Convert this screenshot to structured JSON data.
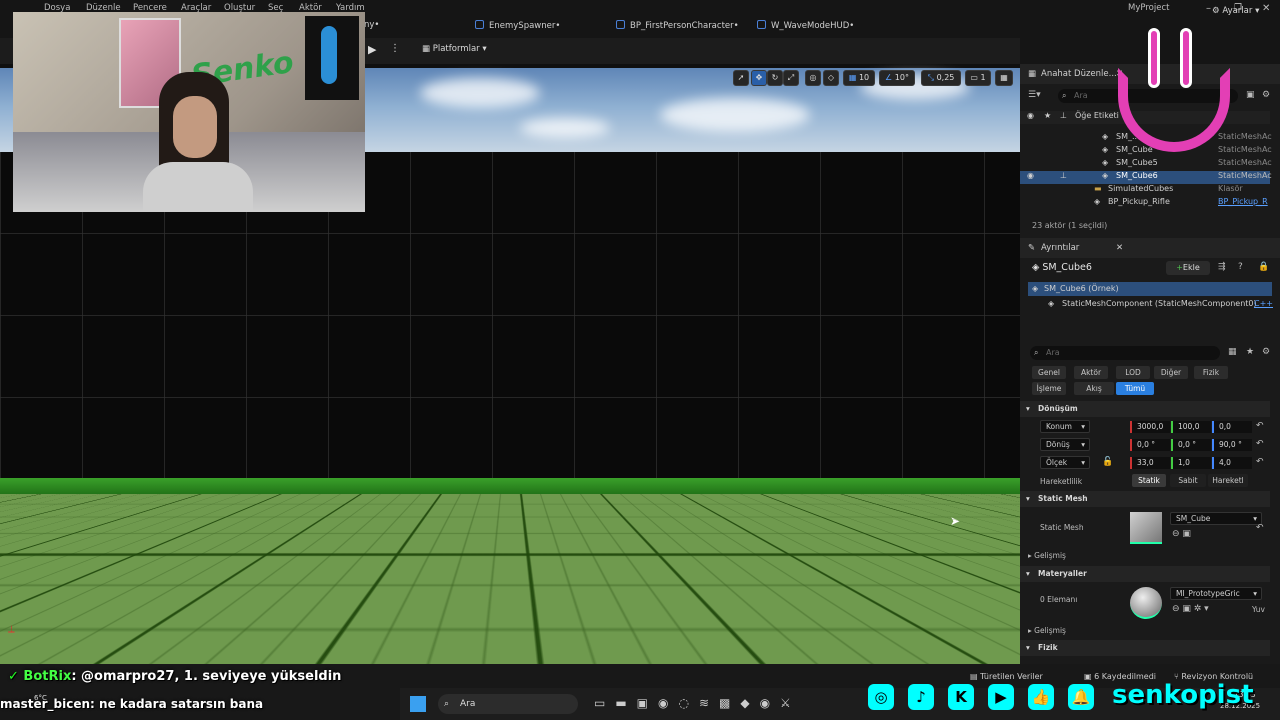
{
  "menu": {
    "items": [
      "Dosya",
      "Düzenle",
      "Pencere",
      "Araçlar",
      "Oluştur",
      "Seç",
      "Aktör",
      "Yardım"
    ],
    "project": "MyProject"
  },
  "tabs": [
    {
      "label": "ny•"
    },
    {
      "label": "EnemySpawner•"
    },
    {
      "label": "BP_FirstPersonCharacter•"
    },
    {
      "label": "W_WaveModeHUD•"
    }
  ],
  "toolbar": {
    "platforms": "Platformlar",
    "settings": "Ayarlar"
  },
  "viewport": {
    "grid": "10",
    "angle": "10°",
    "scale": "0,25",
    "camera": "1"
  },
  "outliner": {
    "title": "Anahat Düzenle...",
    "search_placeholder": "Ara",
    "column": "Öğe Etiketi",
    "rows": [
      {
        "name": "SM_...",
        "type": "StaticMeshAc"
      },
      {
        "name": "SM_Cube",
        "type": "StaticMeshAc"
      },
      {
        "name": "SM_Cube5",
        "type": "StaticMeshAc"
      },
      {
        "name": "SM_Cube6",
        "type": "StaticMeshAc"
      },
      {
        "name": "SimulatedCubes",
        "type": "Klasör"
      },
      {
        "name": "BP_Pickup_Rifle",
        "type": "BP_Pickup_R"
      }
    ],
    "status": "23 aktör (1 seçildi)"
  },
  "details": {
    "title": "Ayrıntılar",
    "actor": "SM_Cube6",
    "add": "Ekle",
    "instance": "SM_Cube6 (Örnek)",
    "component": "StaticMeshComponent (StaticMeshComponent0)",
    "cpp": "C++",
    "search_placeholder": "Ara",
    "filters": [
      "Genel",
      "Aktör",
      "LOD",
      "Diğer",
      "Fizik",
      "İşleme",
      "Akış",
      "Tümü"
    ],
    "transform": {
      "section": "Dönüşüm",
      "location_label": "Konum",
      "rotation_label": "Dönüş",
      "scale_label": "Ölçek",
      "location": [
        "3000,0",
        "100,0",
        "0,0"
      ],
      "rotation": [
        "0,0 °",
        "0,0 °",
        "90,0 °"
      ],
      "scale": [
        "33,0",
        "1,0",
        "4,0"
      ],
      "mobility_label": "Hareketlilik",
      "mobility": [
        "Statik",
        "Sabit",
        "Hareketl"
      ]
    },
    "static_mesh": {
      "section": "Static Mesh",
      "label": "Static Mesh",
      "value": "SM_Cube",
      "advanced": "Gelişmiş"
    },
    "materials": {
      "section": "Materyaller",
      "count": "0 Elemanı",
      "value": "MI_PrototypeGric",
      "extra": "Yuv",
      "advanced": "Gelişmiş"
    },
    "physics": {
      "section": "Fizik"
    }
  },
  "statusbar": {
    "derived": "Türetilen Veriler",
    "saved": "6 Kaydedilmedi",
    "revision": "Revizyon Kontrolü"
  },
  "chat": [
    {
      "user": "BotRix",
      "text": ": @omarpro27, 1. seviyeye yükseldin"
    },
    {
      "user": "master_bicen",
      "text": ": ne kadara satarsın bana"
    }
  ],
  "taskbar": {
    "search": "Ara",
    "time": "13:33",
    "date": "28.12.2025",
    "temp": "6°C"
  },
  "social": {
    "handle": "senkopist"
  },
  "webcam": {
    "wall_text": "Senko"
  }
}
